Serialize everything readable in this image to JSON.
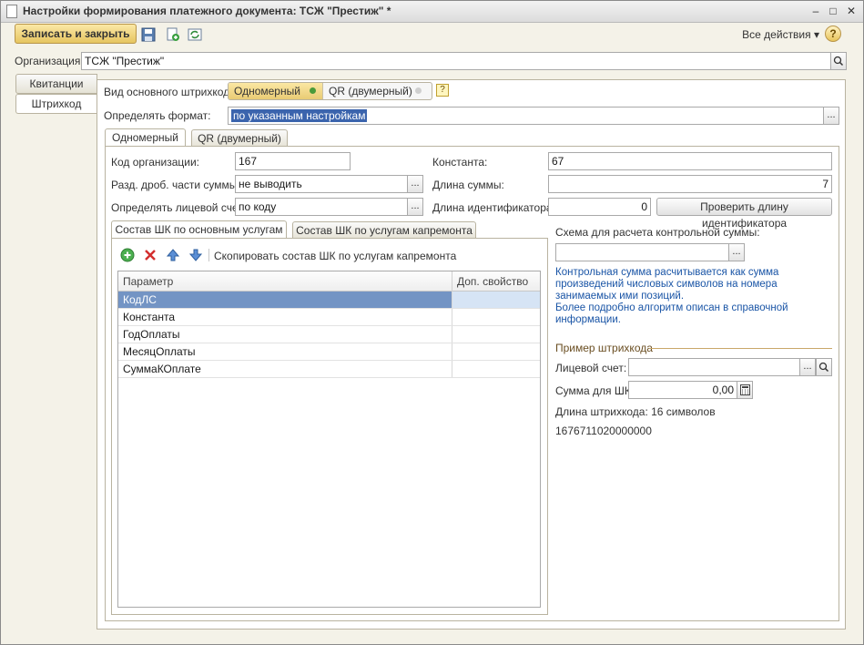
{
  "window": {
    "title": "Настройки формирования платежного документа: ТСЖ \"Престиж\" *",
    "minimize": "–",
    "restore": "□",
    "close": "✕"
  },
  "toolbar": {
    "save_close_label": "Записать и закрыть",
    "all_actions_label": "Все действия ▾",
    "help_label": "?"
  },
  "organization": {
    "label": "Организация:",
    "value": "ТСЖ \"Престиж\""
  },
  "left_tabs": [
    {
      "label": "Квитанции"
    },
    {
      "label": "Штрихкод"
    }
  ],
  "barcode": {
    "type_label": "Вид основного штрихкода:",
    "type_options": [
      "Одномерный",
      "QR (двумерный)"
    ],
    "selected_type": "Одномерный",
    "hint": "?",
    "format_label": "Определять формат:",
    "format_value": "по указанным настройкам"
  },
  "inner_tabs": [
    {
      "label": "Одномерный"
    },
    {
      "label": "QR (двумерный)"
    }
  ],
  "settings": {
    "org_code_label": "Код организации:",
    "org_code_value": "167",
    "constant_label": "Константа:",
    "constant_value": "67",
    "fraction_label": "Разд. дроб. части суммы:",
    "fraction_value": "не выводить",
    "sum_length_label": "Длина суммы:",
    "sum_length_value": "7",
    "account_label": "Определять лицевой счет:",
    "account_value": "по коду",
    "id_length_label": "Длина идентификатора:",
    "id_length_value": "0",
    "check_id_length_button": "Проверить длину идентификатора"
  },
  "composition_tabs": [
    {
      "label": "Состав ШК по основным услугам"
    },
    {
      "label": "Состав ШК по услугам капремонта"
    }
  ],
  "composition_toolbar": {
    "copy_label": "Скопировать состав ШК по услугам капремонта"
  },
  "table": {
    "columns": [
      "Параметр",
      "Доп. свойство"
    ],
    "rows": [
      {
        "param": "КодЛС",
        "extra": ""
      },
      {
        "param": "Константа",
        "extra": ""
      },
      {
        "param": "ГодОплаты",
        "extra": ""
      },
      {
        "param": "МесяцОплаты",
        "extra": ""
      },
      {
        "param": "СуммаКОплате",
        "extra": ""
      }
    ],
    "selected_row": 0
  },
  "checksum": {
    "label": "Схема для расчета контрольной суммы:",
    "value": "",
    "info_line1": "Контрольная сумма расчитывается как сумма произведений числовых символов на номера занимаемых ими позиций.",
    "info_line2": "Более подробно алгоритм описан в справочной информации."
  },
  "example": {
    "group_title": "Пример штрихкода",
    "account_label": "Лицевой счет:",
    "account_value": "",
    "sum_label": "Сумма для ШК:",
    "sum_value": "0,00",
    "length_text": "Длина штрихкода: 16 символов",
    "barcode_value": "1676711020000000"
  },
  "colors": {
    "accent_yellow": "#e9cb74",
    "selection_blue": "#3b64ad",
    "info_blue": "#1a55a6",
    "underline_red": "#c0392b"
  }
}
